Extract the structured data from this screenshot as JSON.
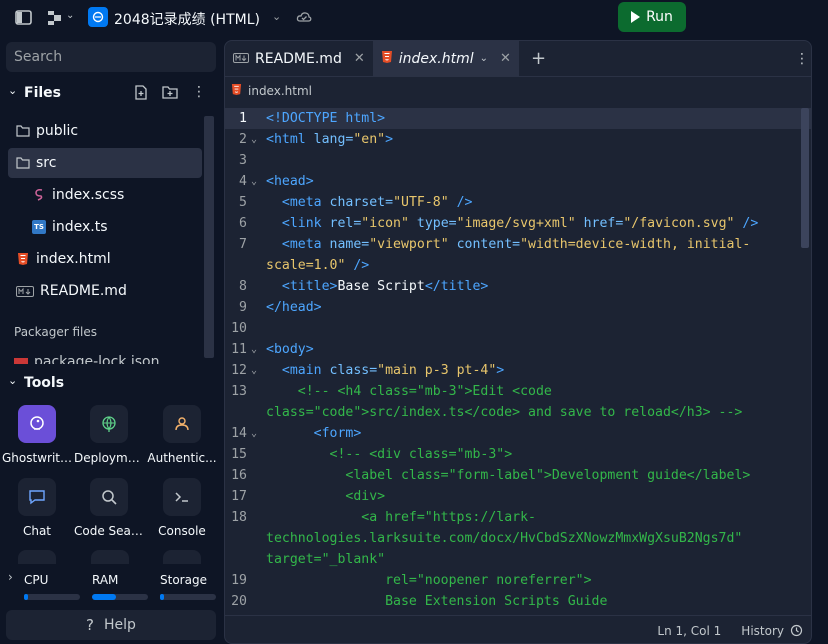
{
  "topbar": {
    "title": "2048记录成绩 (HTML)",
    "run_label": "Run"
  },
  "sidebar": {
    "search_placeholder": "Search",
    "files_title": "Files",
    "items": [
      {
        "label": "public"
      },
      {
        "label": "src"
      },
      {
        "label": "index.scss"
      },
      {
        "label": "index.ts"
      },
      {
        "label": "index.html"
      },
      {
        "label": "README.md"
      }
    ],
    "packager_title": "Packager files",
    "packager_item": "package-lock.json",
    "tools_title": "Tools",
    "tools": [
      {
        "label": "Ghostwriter"
      },
      {
        "label": "Deployme..."
      },
      {
        "label": "Authentic..."
      },
      {
        "label": "Chat"
      },
      {
        "label": "Code Sear..."
      },
      {
        "label": "Console"
      }
    ],
    "stats": [
      {
        "label": "CPU",
        "fill": 0.08
      },
      {
        "label": "RAM",
        "fill": 0.42
      },
      {
        "label": "Storage",
        "fill": 0.08
      }
    ],
    "help_label": "Help"
  },
  "editor": {
    "tabs": [
      {
        "label": "README.md",
        "icon": "markdown-icon"
      },
      {
        "label": "index.html",
        "icon": "html5-icon"
      }
    ],
    "breadcrumb": "index.html",
    "status_position": "Ln 1, Col 1",
    "status_history": "History"
  },
  "colors": {
    "tag": "#4da6ff",
    "attr": "#73bfff",
    "string": "#e8c66c",
    "comment": "#33b74a",
    "text": "#f5f9fc",
    "run": "#0c6b2f"
  }
}
